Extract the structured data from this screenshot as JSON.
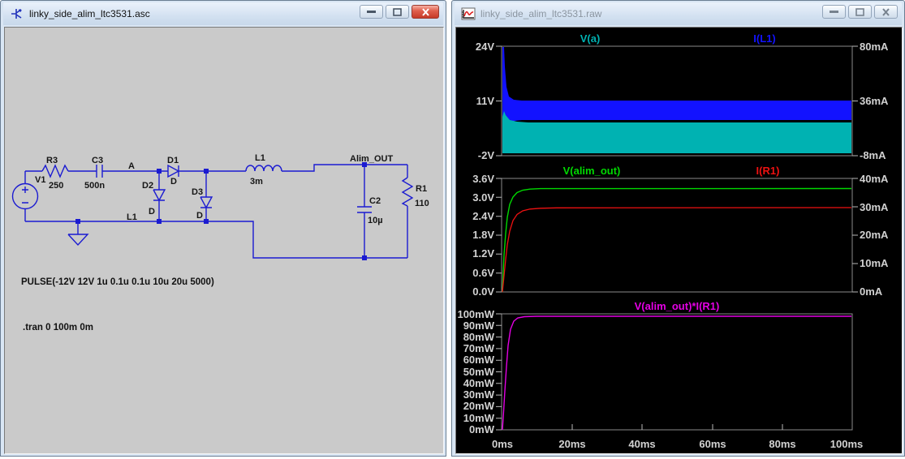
{
  "left_window": {
    "title": "linky_side_alim_ltc3531.asc",
    "controls": [
      "minimize",
      "maximize",
      "close"
    ],
    "schematic": {
      "v1": {
        "ref": "V1"
      },
      "r3": {
        "ref": "R3",
        "value": "250"
      },
      "c3": {
        "ref": "C3",
        "value": "500n"
      },
      "d1": {
        "ref": "D1",
        "value": "D"
      },
      "d2": {
        "ref": "D2",
        "value": "D"
      },
      "d3": {
        "ref": "D3",
        "value": "D"
      },
      "l1": {
        "ref": "L1",
        "value": "3m"
      },
      "c2": {
        "ref": "C2",
        "value": "10µ"
      },
      "r1": {
        "ref": "R1",
        "value": "110"
      },
      "net_a": "A",
      "net_l1": "L1",
      "net_alim_out": "Alim_OUT",
      "pulse_directive": "PULSE(-12V 12V 1u 0.1u 0.1u 10u 20u 5000)",
      "tran_directive": ".tran 0 100m 0m",
      "wire_color": "#1b1bd1",
      "background": "#cacaca"
    }
  },
  "right_window": {
    "title": "linky_side_alim_ltc3531.raw",
    "controls": [
      "minimize",
      "maximize",
      "close"
    ],
    "x_ticks": [
      "0ms",
      "20ms",
      "40ms",
      "60ms",
      "80ms",
      "100ms"
    ],
    "panes": [
      {
        "titles": [
          {
            "label": "V(a)",
            "color": "#00b2b2"
          },
          {
            "label": "I(L1)",
            "color": "#1212ff"
          }
        ],
        "y_left": [
          "24V",
          "11V",
          "-2V"
        ],
        "y_right": [
          "80mA",
          "36mA",
          "-8mA"
        ]
      },
      {
        "titles": [
          {
            "label": "V(alim_out)",
            "color": "#00d800"
          },
          {
            "label": "I(R1)",
            "color": "#ee1111"
          }
        ],
        "y_left": [
          "3.6V",
          "3.0V",
          "2.4V",
          "1.8V",
          "1.2V",
          "0.6V",
          "0.0V"
        ],
        "y_right": [
          "40mA",
          "30mA",
          "20mA",
          "10mA",
          "0mA"
        ]
      },
      {
        "titles": [
          {
            "label": "V(alim_out)*I(R1)",
            "color": "#e400e4"
          }
        ],
        "y_left": [
          "100mW",
          "90mW",
          "80mW",
          "70mW",
          "60mW",
          "50mW",
          "40mW",
          "30mW",
          "20mW",
          "10mW",
          "0mW"
        ]
      }
    ]
  },
  "chart_data": [
    {
      "type": "line",
      "pane": 1,
      "x_unit": "ms",
      "x_range": [
        0,
        100
      ],
      "y_left": {
        "unit": "V",
        "ticks": [
          24,
          11,
          -2
        ]
      },
      "y_right": {
        "unit": "mA",
        "ticks": [
          80,
          36,
          -8
        ]
      },
      "series": [
        {
          "name": "V(a)",
          "color": "#00b2b2",
          "axis": "left",
          "description": "dense switching band, steady oscillation",
          "band_low_V": -2,
          "band_high_V": 6,
          "initial_peak_V": 9
        },
        {
          "name": "I(L1)",
          "color": "#1212ff",
          "axis": "right",
          "description": "inductor ripple current band with startup spike",
          "band_low_mA": 21,
          "band_high_mA": 36,
          "initial_peak_mA": 80
        }
      ],
      "legend_position": "top",
      "grid": false
    },
    {
      "type": "line",
      "pane": 2,
      "x_unit": "ms",
      "x": [
        0,
        1,
        2,
        3,
        4,
        6,
        10,
        100
      ],
      "y_left": {
        "unit": "V",
        "min": 0,
        "max": 3.6,
        "step": 0.6
      },
      "y_right": {
        "unit": "mA",
        "min": 0,
        "max": 40,
        "step": 10
      },
      "series": [
        {
          "name": "V(alim_out)",
          "color": "#00d800",
          "axis": "left",
          "unit": "V",
          "values": [
            0,
            2.1,
            2.9,
            3.15,
            3.22,
            3.25,
            3.26,
            3.26
          ]
        },
        {
          "name": "I(R1)",
          "color": "#ee1111",
          "axis": "right",
          "unit": "mA",
          "values": [
            0,
            12,
            21,
            26,
            28.3,
            29.3,
            29.6,
            29.6
          ]
        }
      ],
      "legend_position": "top",
      "grid": false
    },
    {
      "type": "line",
      "pane": 3,
      "x_unit": "ms",
      "x": [
        0,
        1,
        2,
        3,
        4,
        5,
        7,
        10,
        100
      ],
      "y_left": {
        "unit": "mW",
        "min": 0,
        "max": 100,
        "step": 10
      },
      "series": [
        {
          "name": "V(alim_out)*I(R1)",
          "color": "#e400e4",
          "unit": "mW",
          "values": [
            0,
            25,
            52,
            74,
            86,
            92,
            96,
            97,
            97
          ]
        }
      ],
      "legend_position": "top",
      "grid": false
    }
  ]
}
